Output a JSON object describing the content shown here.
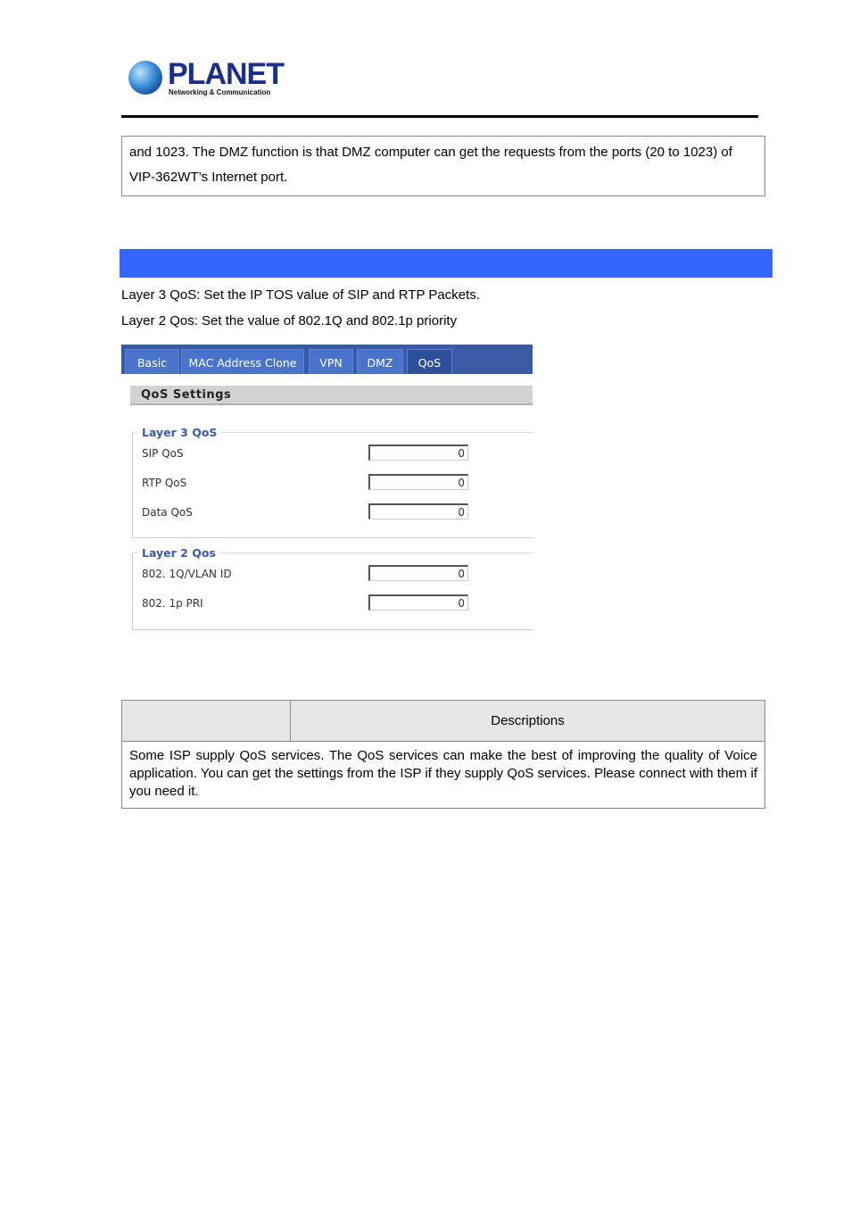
{
  "header": {
    "brand": "PLANET",
    "tagline": "Networking & Communication"
  },
  "note_text": "and 1023. The DMZ function is that DMZ computer can get the requests from the ports (20 to 1023) of VIP-362WT’s Internet port.",
  "section_bar_color": "#3366ff",
  "paragraphs": [
    "Layer 3 QoS: Set the IP TOS value of SIP and RTP Packets.",
    "Layer 2 Qos: Set the value of 802.1Q and 802.1p priority"
  ],
  "ui": {
    "tabs": [
      {
        "label": "Basic"
      },
      {
        "label": "MAC Address Clone"
      },
      {
        "label": "VPN"
      },
      {
        "label": "DMZ"
      },
      {
        "label": "QoS",
        "active": true
      }
    ],
    "section_title": "QoS Settings",
    "layer3": {
      "legend": "Layer 3 QoS",
      "fields": [
        {
          "label": "SIP QoS",
          "value": "0"
        },
        {
          "label": "RTP QoS",
          "value": "0"
        },
        {
          "label": "Data QoS",
          "value": "0"
        }
      ]
    },
    "layer2": {
      "legend": "Layer 2 Qos",
      "fields": [
        {
          "label": "802. 1Q/VLAN ID",
          "value": "0"
        },
        {
          "label": "802. 1p PRI",
          "value": "0"
        }
      ]
    }
  },
  "table": {
    "header_col1": "",
    "header_col2": "Descriptions",
    "body": "Some ISP supply QoS services. The QoS services can make the best of improving the quality of Voice application. You can get the settings from the ISP if they supply QoS services. Please connect with them if you need it."
  }
}
